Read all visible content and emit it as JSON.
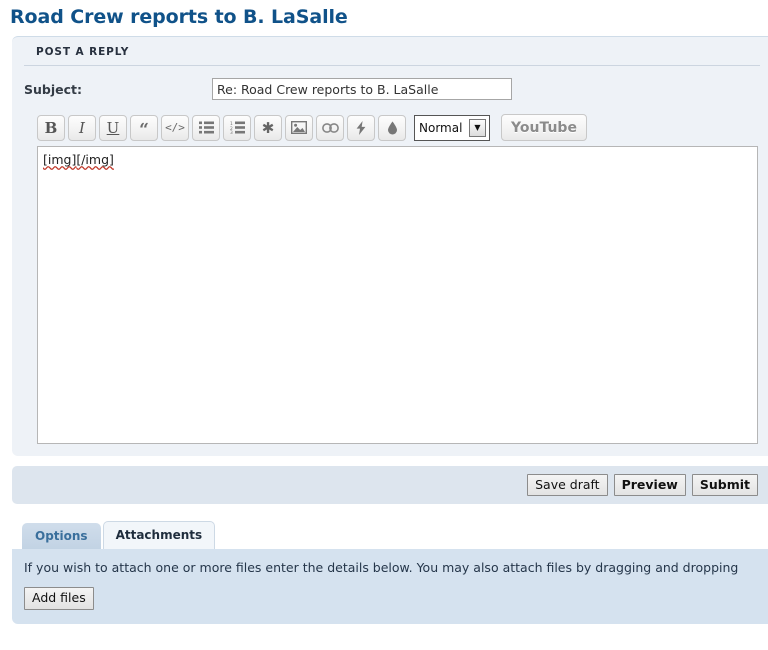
{
  "page": {
    "title": "Road Crew reports to B. LaSalle"
  },
  "reply_panel": {
    "heading": "POST A REPLY",
    "subject": {
      "label": "Subject:",
      "value": "Re: Road Crew reports to B. LaSalle",
      "placeholder": ""
    },
    "toolbar": {
      "buttons": [
        {
          "name": "bold-icon",
          "glyph": "B",
          "title": "Bold"
        },
        {
          "name": "italic-icon",
          "glyph": "I",
          "title": "Italic"
        },
        {
          "name": "underline-icon",
          "glyph": "U",
          "title": "Underline"
        },
        {
          "name": "quote-icon",
          "glyph": "“",
          "title": "Quote"
        },
        {
          "name": "code-icon",
          "glyph": "</>",
          "title": "Code"
        },
        {
          "name": "unordered-list-icon",
          "glyph": "",
          "title": "Unordered list"
        },
        {
          "name": "ordered-list-icon",
          "glyph": "",
          "title": "Ordered list"
        },
        {
          "name": "asterisk-icon",
          "glyph": "✱",
          "title": "List item"
        },
        {
          "name": "image-icon",
          "glyph": "",
          "title": "Insert image"
        },
        {
          "name": "link-icon",
          "glyph": "",
          "title": "Insert link"
        },
        {
          "name": "lightning-icon",
          "glyph": "",
          "title": "Flash"
        },
        {
          "name": "droplet-icon",
          "glyph": "",
          "title": "Font colour"
        }
      ],
      "format_select": {
        "selected": "Normal",
        "options": [
          "Normal"
        ]
      },
      "youtube_label": "YouTube"
    },
    "message": {
      "value": "[img][/img]",
      "spell_error_words": [
        "img",
        "img"
      ],
      "placeholder": ""
    },
    "actions": [
      {
        "label": "Save draft",
        "name": "save-draft-button",
        "bold": false
      },
      {
        "label": "Preview",
        "name": "preview-button",
        "bold": true
      },
      {
        "label": "Submit",
        "name": "submit-button",
        "bold": true
      }
    ]
  },
  "tabs": [
    {
      "label": "Options",
      "name": "tab-options",
      "active": false
    },
    {
      "label": "Attachments",
      "name": "tab-attachments",
      "active": true
    }
  ],
  "attachments": {
    "note": "If you wish to attach one or more files enter the details below. You may also attach files by dragging and dropping",
    "add_files_label": "Add files"
  },
  "colors": {
    "title_blue": "#105289",
    "panel_bg": "#eef2f7",
    "action_bar_bg": "#dde5ee",
    "attach_panel_bg": "#d5e2ef",
    "tab_inactive_bg": "#c8d8e8",
    "tab_inactive_text": "#3a6f9c",
    "spell_error": "#c0392b"
  }
}
